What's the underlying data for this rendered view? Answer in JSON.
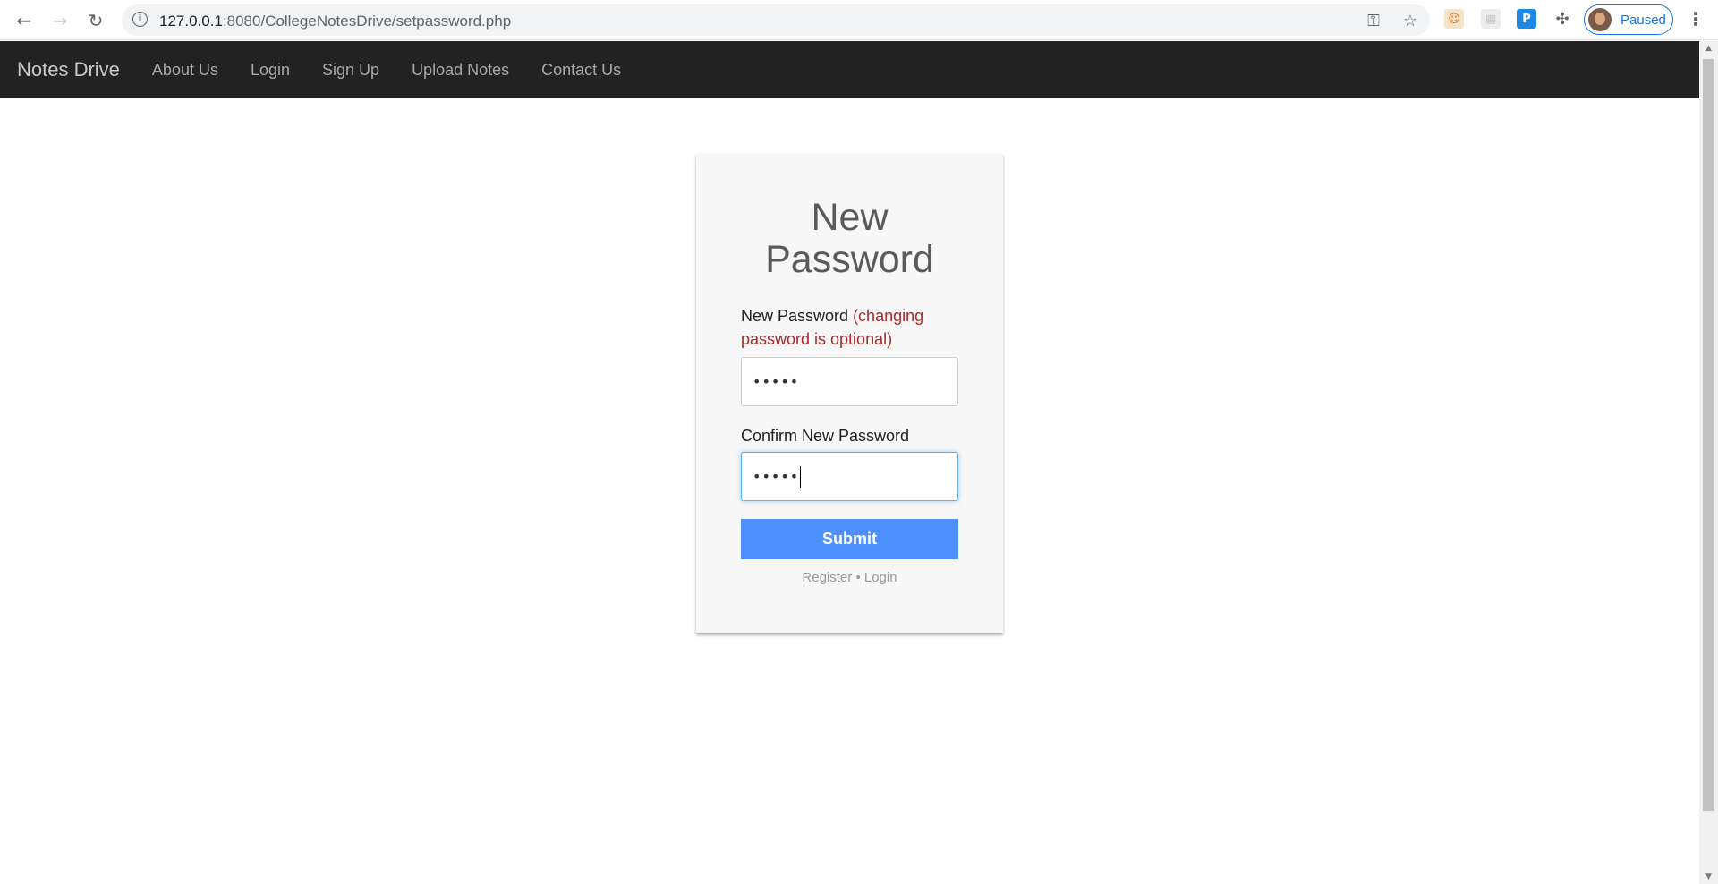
{
  "browser": {
    "url_host": "127.0.0.1",
    "url_rest": ":8080/CollegeNotesDrive/setpassword.php",
    "profile_label": "Paused",
    "info_icon": "info-icon",
    "colors": {
      "accent": "#1a73e8"
    }
  },
  "navbar": {
    "brand": "Notes Drive",
    "links": [
      "About Us",
      "Login",
      "Sign Up",
      "Upload Notes",
      "Contact Us"
    ]
  },
  "card": {
    "title_line1": "New",
    "title_line2": "Password",
    "new_password_label": "New Password",
    "new_password_hint": "(changing password is optional)",
    "new_password_value": "•••••",
    "confirm_label": "Confirm New Password",
    "confirm_value": "•••••",
    "submit_label": "Submit",
    "footer_register": "Register",
    "footer_separator": "•",
    "footer_login": "Login"
  },
  "colors": {
    "navbar_bg": "#222222",
    "submit_bg": "#4d90fe",
    "hint_color": "#a52a2a"
  }
}
